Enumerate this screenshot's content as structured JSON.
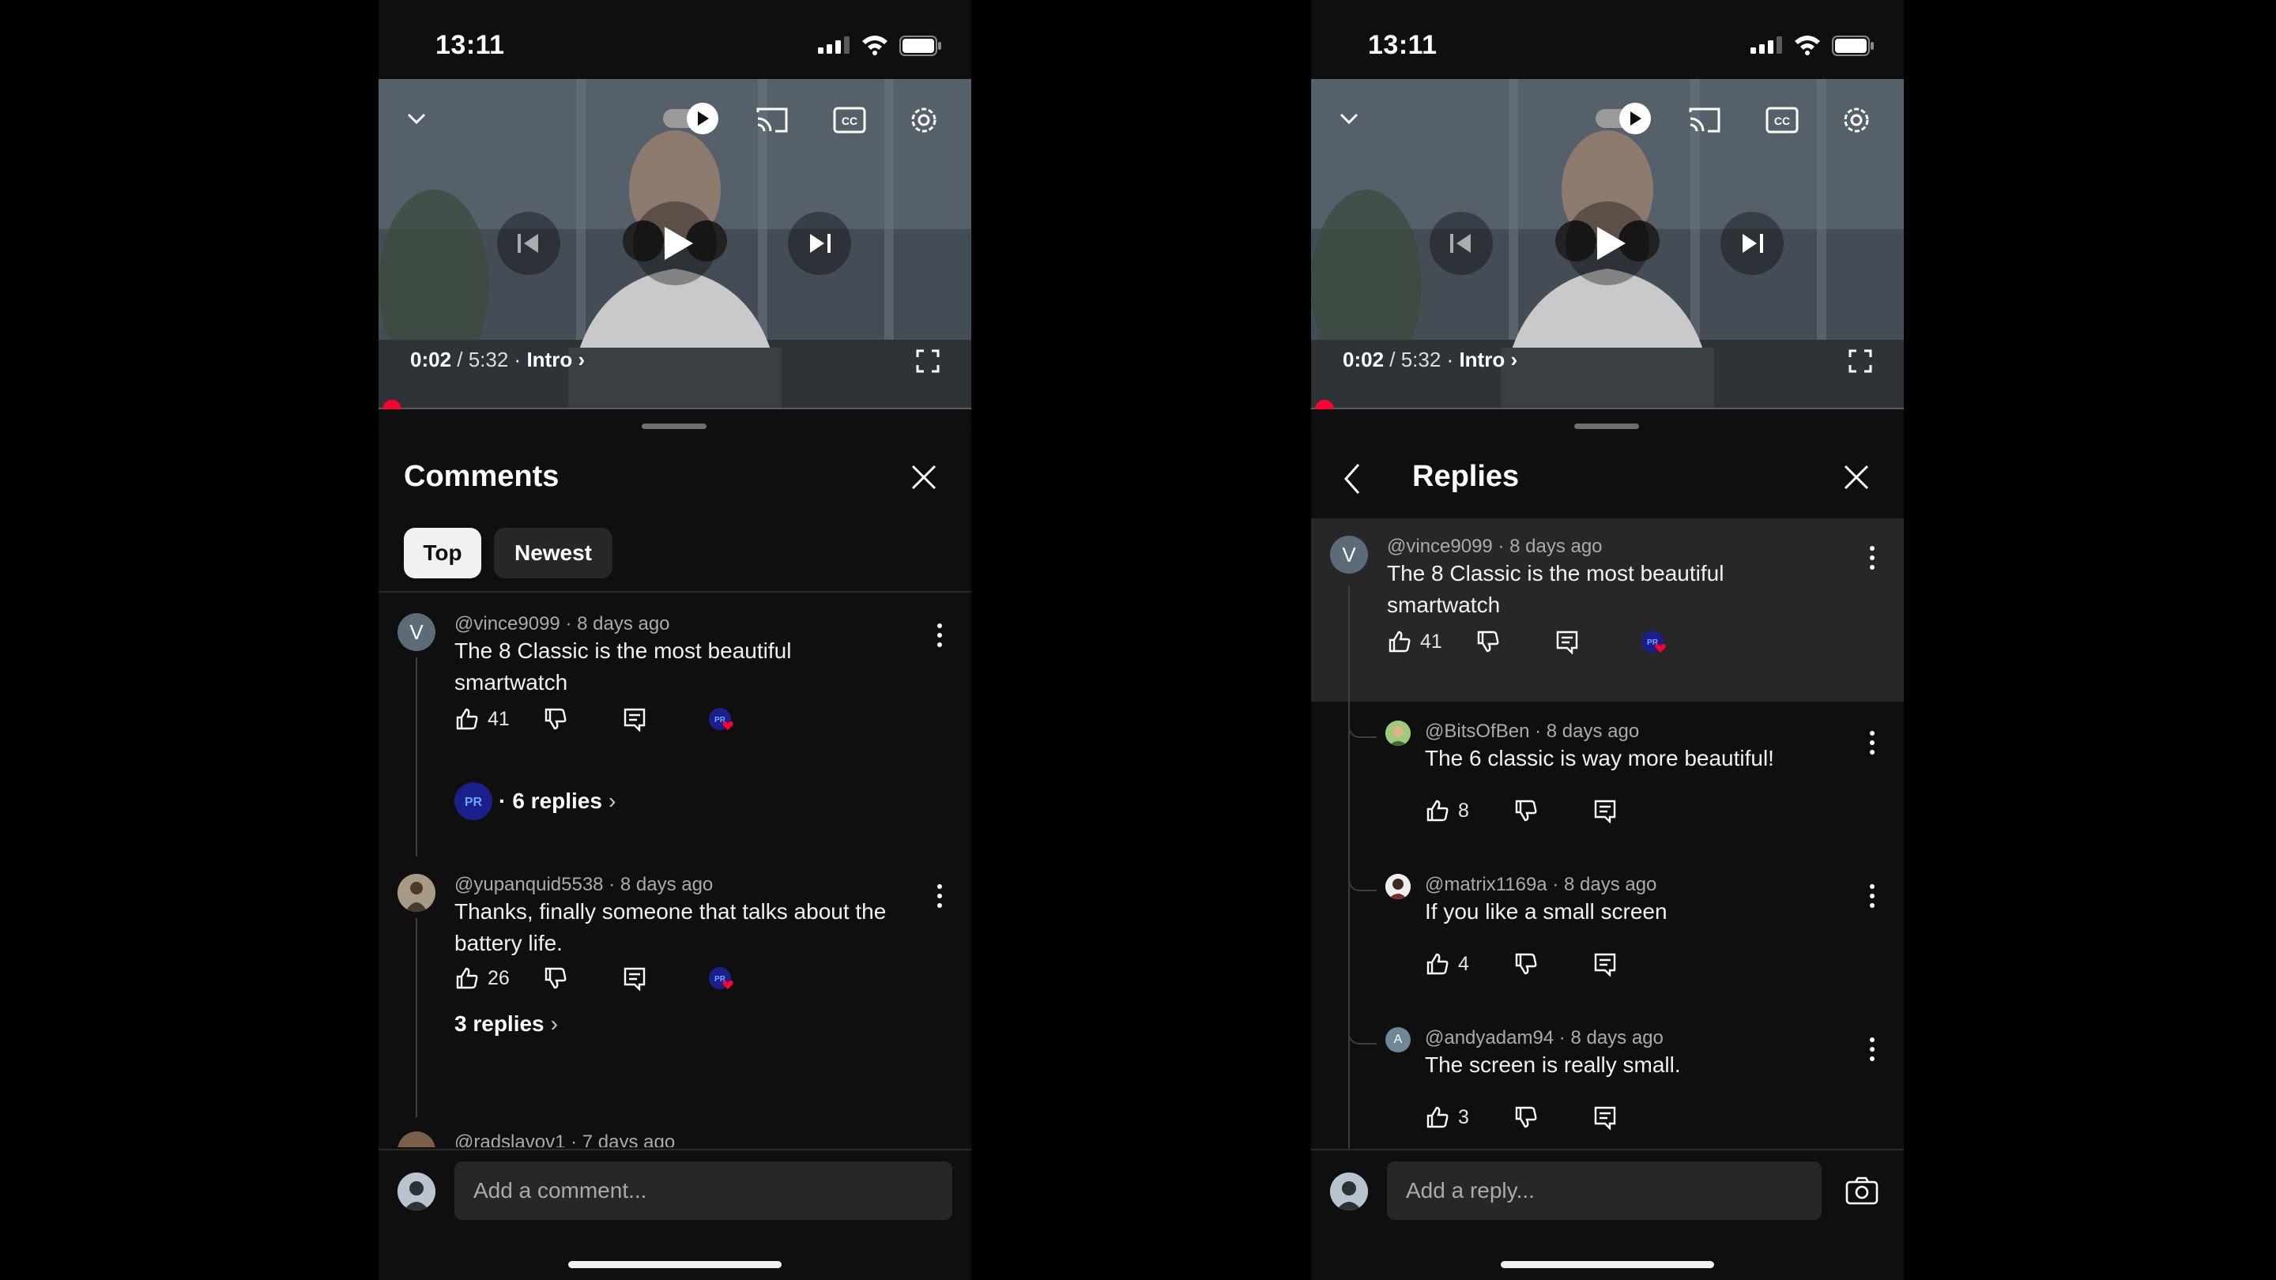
{
  "status": {
    "time": "13:11"
  },
  "video": {
    "current": "0:02",
    "sep": " / ",
    "duration": "5:32",
    "dot": " · ",
    "chapter": "Intro",
    "progress_fraction": 0.006
  },
  "left": {
    "title": "Comments",
    "tabs": [
      {
        "label": "Top",
        "active": true
      },
      {
        "label": "Newest",
        "active": false
      }
    ],
    "comments": [
      {
        "avatar_letter": "V",
        "author": "@vince9099",
        "age": "8 days ago",
        "text_line1": "The 8 Classic is the most beautiful",
        "text_line2": "smartwatch",
        "likes": "41",
        "replies_label": "6 replies",
        "replies_prefix": "· "
      },
      {
        "author": "@yupanquid5538",
        "age": "8 days ago",
        "text_line1": "Thanks, finally someone that talks about the",
        "text_line2": "battery life.",
        "likes": "26",
        "replies_label": "3 replies"
      },
      {
        "author": "@radslavov1",
        "age": "7 days ago"
      }
    ],
    "input_placeholder": "Add a comment..."
  },
  "right": {
    "title": "Replies",
    "parent": {
      "avatar_letter": "V",
      "author": "@vince9099",
      "age": "8 days ago",
      "text_line1": "The 8 Classic is the most beautiful",
      "text_line2": "smartwatch",
      "likes": "41"
    },
    "replies": [
      {
        "author": "@BitsOfBen",
        "age": "8 days ago",
        "text": "The 6 classic is way more beautiful!",
        "likes": "8"
      },
      {
        "author": "@matrix1169a",
        "age": "8 days ago",
        "text": "If you like a small screen",
        "likes": "4"
      },
      {
        "avatar_letter": "A",
        "author": "@andyadam94",
        "age": "8 days ago",
        "text": "The screen is really small.",
        "likes": "3"
      }
    ],
    "input_placeholder": "Add a reply..."
  },
  "colors": {
    "accent_red": "#ff0033",
    "sheet_bg": "#0f0f0f",
    "chip_bg": "#272727",
    "badge_blue": "#1a1f8c"
  },
  "icons": [
    "chevron-down-icon",
    "autoplay-toggle-icon",
    "cast-icon",
    "captions-icon",
    "settings-gear-icon",
    "previous-icon",
    "play-icon",
    "next-icon",
    "fullscreen-icon",
    "close-icon",
    "back-icon",
    "more-vert-icon",
    "thumb-up-icon",
    "thumb-down-icon",
    "reply-icon",
    "creator-heart-icon",
    "camera-icon"
  ]
}
